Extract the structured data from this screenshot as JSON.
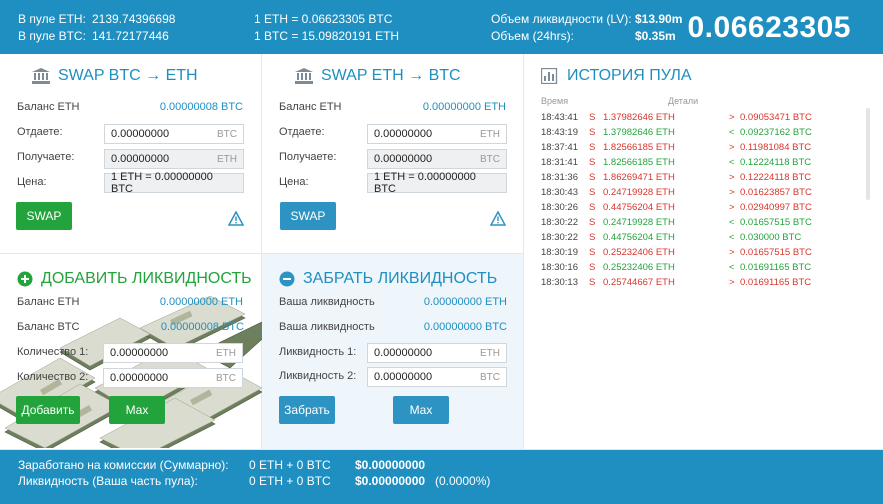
{
  "top": {
    "pool_eth_label": "В пуле ETH:",
    "pool_eth_value": "2139.74396698",
    "pool_btc_label": "В пуле BTC:",
    "pool_btc_value": "141.72177446",
    "rate1": "1 ETH = 0.06623305 BTC",
    "rate2": "1 BTC = 15.09820191 ETH",
    "liq_label": "Объем ликвидности (LV):",
    "liq_value": "$13.90m",
    "vol_label": "Объем (24hrs):",
    "vol_value": "$0.35m",
    "big_rate": "0.06623305"
  },
  "swap_btc_eth": {
    "title": "SWAP BTC → ETH",
    "balance_label": "Баланс ETH",
    "balance_value": "0.00000008 BTC",
    "give_label": "Отдаете:",
    "give_value": "0.00000000",
    "give_unit": "BTC",
    "receive_label": "Получаете:",
    "receive_value": "0.00000000",
    "receive_unit": "ETH",
    "price_label": "Цена:",
    "price_value": "1 ETH = 0.00000000 BTC",
    "button": "SWAP"
  },
  "swap_eth_btc": {
    "title": "SWAP ETH → BTC",
    "balance_label": "Баланс ETH",
    "balance_value": "0.00000000 ETH",
    "give_label": "Отдаете:",
    "give_value": "0.00000000",
    "give_unit": "ETH",
    "receive_label": "Получаете:",
    "receive_value": "0.00000000",
    "receive_unit": "BTC",
    "price_label": "Цена:",
    "price_value": "1 ETH = 0.00000000 BTC",
    "button": "SWAP"
  },
  "add_liquidity": {
    "title": "ДОБАВИТЬ ЛИКВИДНОСТЬ",
    "balance_eth_label": "Баланс ETH",
    "balance_eth_value": "0.00000000 ETH",
    "balance_btc_label": "Баланс BTC",
    "balance_btc_value": "0.00000008 BTC",
    "qty1_label": "Количество 1:",
    "qty1_value": "0.00000000",
    "qty1_unit": "ETH",
    "qty2_label": "Количество 2:",
    "qty2_value": "0.00000000",
    "qty2_unit": "BTC",
    "add_button": "Добавить",
    "max_button": "Max"
  },
  "remove_liquidity": {
    "title": "ЗАБРАТЬ ЛИКВИДНОСТЬ",
    "your_liq1_label": "Ваша ликвидность",
    "your_liq1_value": "0.00000000 ETH",
    "your_liq2_label": "Ваша ликвидность",
    "your_liq2_value": "0.00000000 BTC",
    "liq1_label": "Ликвидность 1:",
    "liq1_value": "0.00000000",
    "liq1_unit": "ETH",
    "liq2_label": "Ликвидность 2:",
    "liq2_value": "0.00000000",
    "liq2_unit": "BTC",
    "remove_button": "Забрать",
    "max_button": "Max"
  },
  "history": {
    "title": "ИСТОРИЯ ПУЛА",
    "col_time": "Время",
    "col_details": "Детали",
    "rows": [
      {
        "time": "18:43:41",
        "s": "S",
        "eth": "1.37982646 ETH",
        "eth_color": "red",
        "dir": ">",
        "btc": "0.09053471 BTC",
        "btc_color": "red"
      },
      {
        "time": "18:43:19",
        "s": "S",
        "eth": "1.37982646 ETH",
        "eth_color": "green",
        "dir": "<",
        "btc": "0.09237162 BTC",
        "btc_color": "green"
      },
      {
        "time": "18:37:41",
        "s": "S",
        "eth": "1.82566185 ETH",
        "eth_color": "red",
        "dir": ">",
        "btc": "0.11981084 BTC",
        "btc_color": "red"
      },
      {
        "time": "18:31:41",
        "s": "S",
        "eth": "1.82566185 ETH",
        "eth_color": "green",
        "dir": "<",
        "btc": "0.12224118 BTC",
        "btc_color": "green"
      },
      {
        "time": "18:31:36",
        "s": "S",
        "eth": "1.86269471 ETH",
        "eth_color": "red",
        "dir": ">",
        "btc": "0.12224118 BTC",
        "btc_color": "red"
      },
      {
        "time": "18:30:43",
        "s": "S",
        "eth": "0.24719928 ETH",
        "eth_color": "red",
        "dir": ">",
        "btc": "0.01623857 BTC",
        "btc_color": "red"
      },
      {
        "time": "18:30:26",
        "s": "S",
        "eth": "0.44756204 ETH",
        "eth_color": "red",
        "dir": ">",
        "btc": "0.02940997 BTC",
        "btc_color": "red"
      },
      {
        "time": "18:30:22",
        "s": "S",
        "eth": "0.24719928 ETH",
        "eth_color": "green",
        "dir": "<",
        "btc": "0.01657515 BTC",
        "btc_color": "green"
      },
      {
        "time": "18:30:22",
        "s": "S",
        "eth": "0.44756204 ETH",
        "eth_color": "green",
        "dir": "<",
        "btc": "0.030000 BTC",
        "btc_color": "green"
      },
      {
        "time": "18:30:19",
        "s": "S",
        "eth": "0.25232406 ETH",
        "eth_color": "red",
        "dir": ">",
        "btc": "0.01657515 BTC",
        "btc_color": "red"
      },
      {
        "time": "18:30:16",
        "s": "S",
        "eth": "0.25232406 ETH",
        "eth_color": "green",
        "dir": "<",
        "btc": "0.01691165 BTC",
        "btc_color": "green"
      },
      {
        "time": "18:30:13",
        "s": "S",
        "eth": "0.25744667 ETH",
        "eth_color": "red",
        "dir": ">",
        "btc": "0.01691165 BTC",
        "btc_color": "red"
      }
    ]
  },
  "bottom": {
    "earned_label": "Заработано на комиссии (Суммарно):",
    "earned_amounts": "0 ETH + 0 BTC",
    "earned_usd": "$0.00000000",
    "liq_label": "Ликвидность (Ваша часть пула):",
    "liq_amounts": "0 ETH + 0 BTC",
    "liq_usd": "$0.00000000",
    "liq_pct": "(0.0000%)"
  },
  "colors": {
    "brand": "#1e8fc0",
    "green": "#23a33c",
    "red": "#d9342b"
  }
}
